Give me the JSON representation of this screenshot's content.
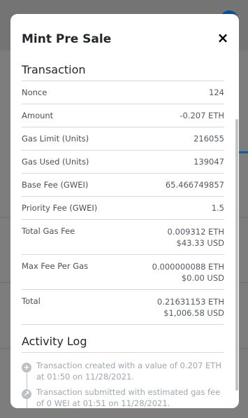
{
  "modal": {
    "title": "Mint Pre Sale",
    "close_icon": "×"
  },
  "transaction": {
    "section_title": "Transaction",
    "rows": [
      {
        "label": "Nonce",
        "value": "124"
      },
      {
        "label": "Amount",
        "value": "-0.207 ETH"
      },
      {
        "label": "Gas Limit (Units)",
        "value": "216055"
      },
      {
        "label": "Gas Used (Units)",
        "value": "139047"
      },
      {
        "label": "Base Fee (GWEI)",
        "value": "65.466749857"
      },
      {
        "label": "Priority Fee (GWEI)",
        "value": "1.5"
      },
      {
        "label": "Total Gas Fee",
        "value": "0.009312 ETH",
        "value2": "$43.33 USD"
      },
      {
        "label": "Max Fee Per Gas",
        "value": "0.000000088 ETH",
        "value2": "$0.00 USD"
      },
      {
        "label": "Total",
        "value": "0.21631153 ETH",
        "value2": "$1,006.58 USD"
      }
    ]
  },
  "activity": {
    "section_title": "Activity Log",
    "items": [
      {
        "icon": "plus-icon",
        "text": "Transaction created with a value of 0.207 ETH at 01:50 on 11/28/2021."
      },
      {
        "icon": "arrow-up-right-icon",
        "text": "Transaction submitted with estimated gas fee of 0 WEI at 01:51 on 11/28/2021."
      }
    ]
  }
}
